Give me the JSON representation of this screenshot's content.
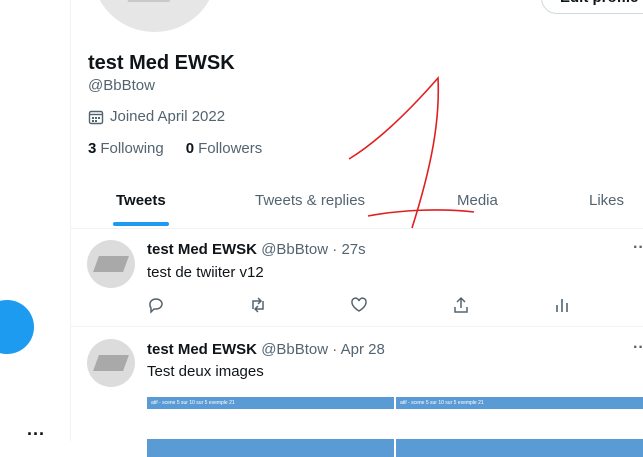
{
  "profile": {
    "name": "test Med EWSK",
    "handle": "@BbBtow",
    "joined": "Joined April 2022",
    "following_count": "3",
    "following_label": "Following",
    "followers_count": "0",
    "followers_label": "Followers",
    "edit_label": "Edit profile"
  },
  "tabs": [
    "Tweets",
    "Tweets & replies",
    "Media",
    "Likes"
  ],
  "tweets": [
    {
      "name": "test Med EWSK",
      "handle": "@BbBtow",
      "sep": "·",
      "time": "27s",
      "text": "test de twiiter v12"
    },
    {
      "name": "test Med EWSK",
      "handle": "@BbBtow",
      "sep": "·",
      "time": "Apr 28",
      "text": "Test deux images",
      "media_caption": "atif - scene 5 sur 10 sur 5 exemple 21"
    }
  ],
  "rail": {
    "more": "..."
  },
  "colors": {
    "accent": "#1d9bf0",
    "annotation": "#e02020"
  }
}
